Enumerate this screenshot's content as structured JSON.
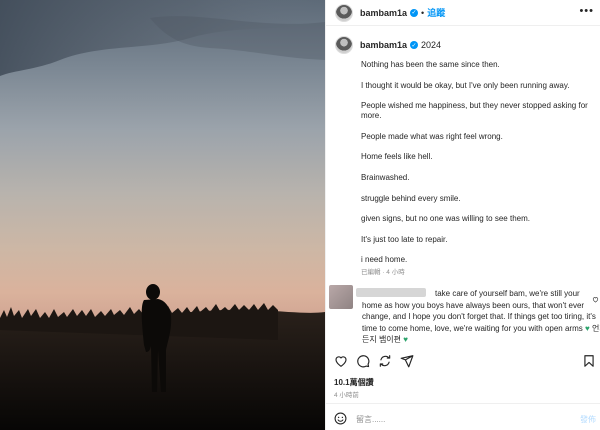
{
  "post": {
    "username": "bambam1a",
    "dot": "•",
    "follow_label": "追蹤",
    "more_label": "•••",
    "caption_year": "2024",
    "caption": [
      "Nothing has been the same since then.",
      "I thought it would be okay, but I've only been running away.",
      "People wished me happiness, but they never stopped asking for more.",
      "People made what was right feel wrong.",
      "Home feels like hell.",
      "Brainwashed.",
      "struggle behind every smile.",
      "given signs, but no one was willing to see them.",
      "It's just too late to repair.",
      "i need home."
    ],
    "caption_meta": "已編輯 · 4 小時"
  },
  "comment": {
    "text_lead": "take care of yourself bam, we're still your",
    "text_rest": "home as how you boys have always been ours, that won't ever change, and I hope you don't forget that. If things get too tiring, it's time to come home, love, we're waiting for you with open arms",
    "korean": "언제든지 뱀이편",
    "heart_color": "#2aa36b"
  },
  "icons": {
    "like": "heart-icon",
    "comment": "comment-icon",
    "share": "repost-icon",
    "send": "send-icon",
    "save": "bookmark-icon",
    "emoji": "emoji-icon",
    "verified": "verified-badge-icon"
  },
  "stats": {
    "likes": "10.1萬個讚",
    "time_ago": "4 小時前"
  },
  "composer": {
    "placeholder": "留言......",
    "post_label": "發佈"
  },
  "colors": {
    "accent": "#0095f6",
    "muted": "#8e8e8e",
    "post_disabled": "#b3dbff"
  }
}
